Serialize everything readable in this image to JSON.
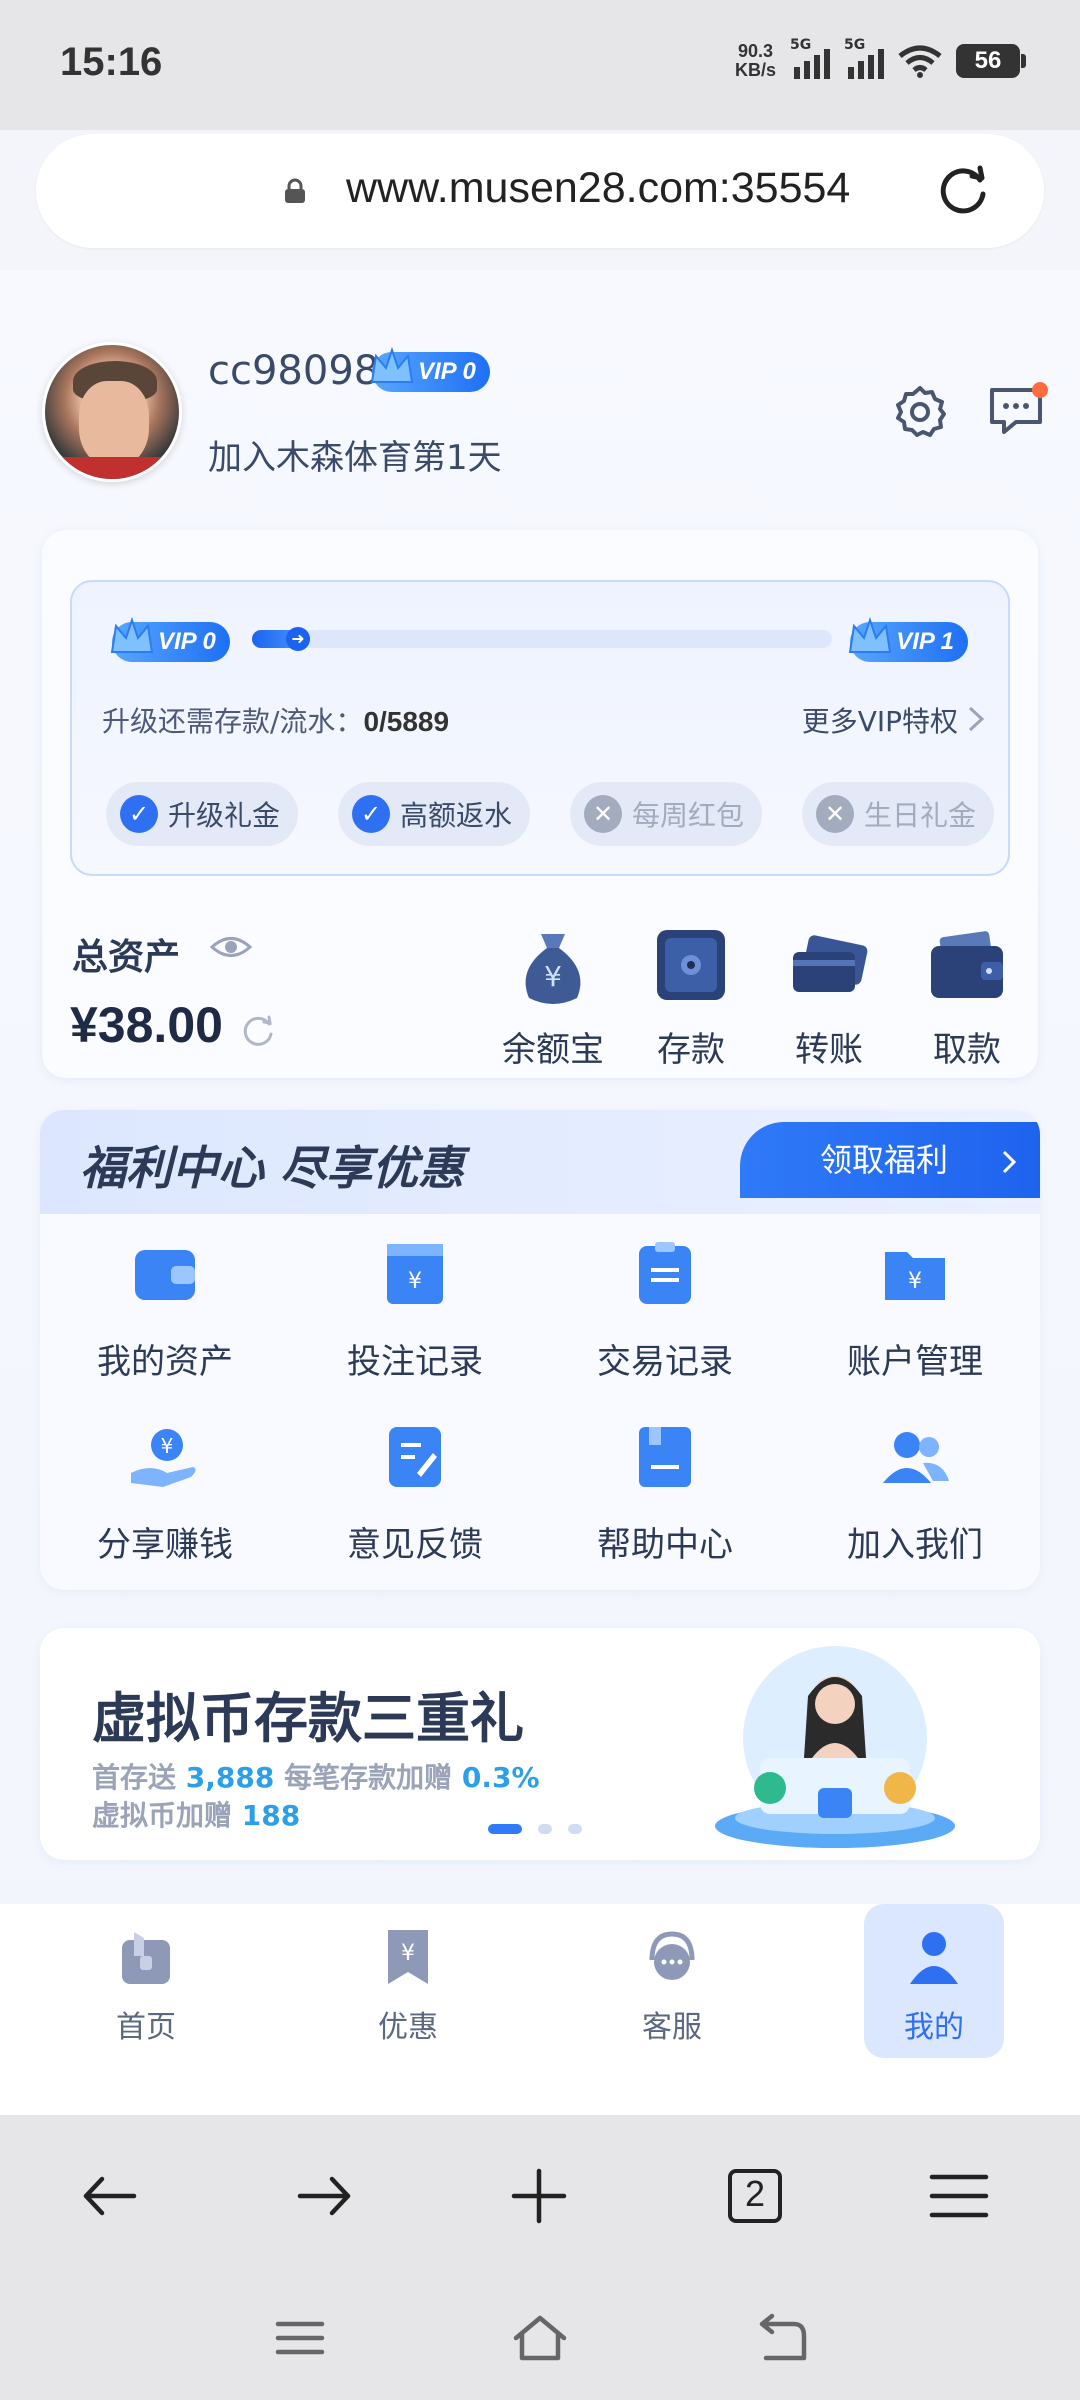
{
  "status_bar": {
    "time": "15:16",
    "speed_value": "90.3",
    "speed_unit": "KB/s",
    "sig1_tag": "5G",
    "sig2_tag": "5G",
    "battery": "56"
  },
  "browser": {
    "url": "www.musen28.com:35554",
    "tabs_count": "2"
  },
  "profile": {
    "username": "cc98098",
    "vip_level": "VIP 0",
    "joined": "加入木森体育第1天"
  },
  "vip_progress": {
    "from": "VIP 0",
    "to": "VIP 1",
    "progress_fraction": 0,
    "upgrade_label": "升级还需存款/流水：",
    "upgrade_value": "0/5889",
    "more_vip": "更多VIP特权",
    "perks": [
      {
        "label": "升级礼金",
        "enabled": true
      },
      {
        "label": "高额返水",
        "enabled": true
      },
      {
        "label": "每周红包",
        "enabled": false
      },
      {
        "label": "生日礼金",
        "enabled": false
      }
    ]
  },
  "assets": {
    "total_label": "总资产",
    "balance": "¥38.00",
    "actions": [
      {
        "label": "余额宝",
        "icon": "money-bag-icon"
      },
      {
        "label": "存款",
        "icon": "safe-icon"
      },
      {
        "label": "转账",
        "icon": "cards-icon"
      },
      {
        "label": "取款",
        "icon": "wallet-icon"
      }
    ]
  },
  "welfare": {
    "title": "福利中心 尽享优惠",
    "button": "领取福利",
    "items": [
      {
        "label": "我的资产",
        "icon": "wallet-icon"
      },
      {
        "label": "投注记录",
        "icon": "bet-record-icon"
      },
      {
        "label": "交易记录",
        "icon": "transaction-icon"
      },
      {
        "label": "账户管理",
        "icon": "folder-icon"
      },
      {
        "label": "分享赚钱",
        "icon": "share-money-icon"
      },
      {
        "label": "意见反馈",
        "icon": "feedback-icon"
      },
      {
        "label": "帮助中心",
        "icon": "help-book-icon"
      },
      {
        "label": "加入我们",
        "icon": "users-icon"
      }
    ]
  },
  "banner": {
    "title": "虚拟币存款三重礼",
    "line1_a": "首存送",
    "line1_b": "3,888",
    "line1_c": "每笔存款加赠",
    "line1_d": "0.3%",
    "line2_a": "虚拟币加赠",
    "line2_b": "188"
  },
  "tabbar": [
    {
      "label": "首页",
      "icon": "home-icon",
      "active": false
    },
    {
      "label": "优惠",
      "icon": "coupon-icon",
      "active": false
    },
    {
      "label": "客服",
      "icon": "headset-icon",
      "active": false
    },
    {
      "label": "我的",
      "icon": "user-icon",
      "active": true
    }
  ],
  "colors": {
    "accent": "#2f6ff2",
    "background": "#f3f5fb",
    "text": "#2c3a58",
    "notify": "#ff6b3d"
  }
}
